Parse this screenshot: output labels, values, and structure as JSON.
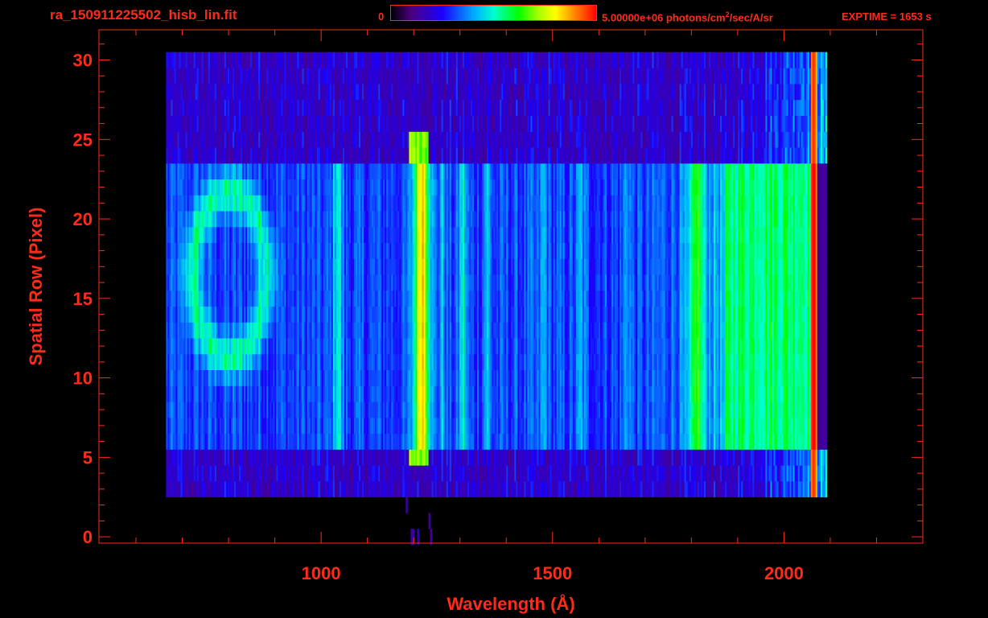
{
  "header": {
    "title": "ra_150911225502_hisb_lin.fit",
    "colorbar_min": "0",
    "colorbar_max_value": "5.00000e+06 photons/cm",
    "colorbar_max_sup": "2",
    "colorbar_max_unit_rest": "/sec/A/sr",
    "exptime": "EXPTIME = 1653 s"
  },
  "colors": {
    "axis": "#ff2a1a",
    "background": "#000000"
  },
  "chart_data": {
    "type": "heatmap",
    "title": "ra_150911225502_hisb_lin.fit",
    "xlabel": "Wavelength (Å)",
    "ylabel": "Spatial Row (Pixel)",
    "xlim": [
      520,
      2300
    ],
    "ylim": [
      -0.4,
      31.9
    ],
    "xticks": [
      1000,
      1500,
      2000
    ],
    "xtick_labels": [
      "1000",
      "1500",
      "2000"
    ],
    "yticks": [
      0,
      5,
      10,
      15,
      20,
      25,
      30
    ],
    "ytick_labels": [
      "0",
      "5",
      "10",
      "15",
      "20",
      "25",
      "30"
    ],
    "colorbar": {
      "min": 0,
      "max": 5000000,
      "unit": "photons/cm²/sec/A/sr"
    },
    "data_extent": {
      "x": [
        665,
        2090
      ],
      "y": [
        0,
        30
      ]
    },
    "emission_lines_angstrom": [
      1216,
      1304,
      1356,
      1034
    ],
    "grid": false
  }
}
